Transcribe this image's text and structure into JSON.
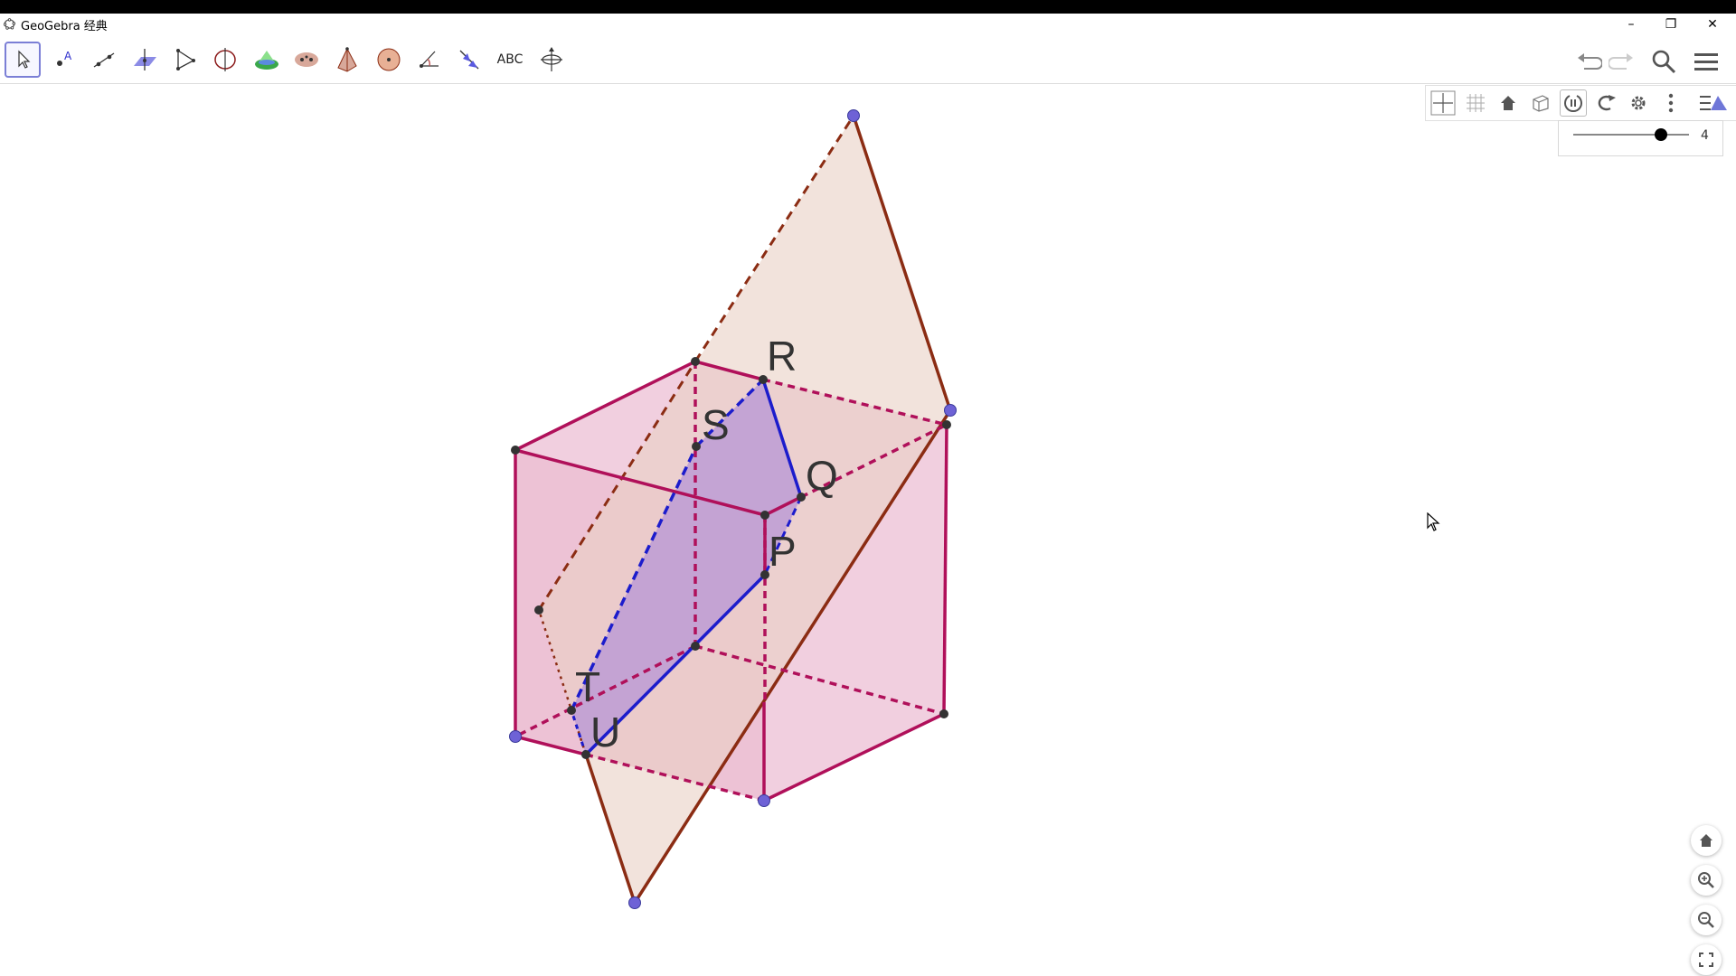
{
  "window": {
    "title": "GeoGebra 经典",
    "minimize": "–",
    "maximize": "❐",
    "close": "✕"
  },
  "toolbar": {
    "tools": [
      {
        "name": "move-tool-icon"
      },
      {
        "name": "point-tool-icon"
      },
      {
        "name": "line-tool-icon"
      },
      {
        "name": "perpendicular-tool-icon"
      },
      {
        "name": "polygon-tool-icon"
      },
      {
        "name": "circle-axis-tool-icon"
      },
      {
        "name": "plane-tool-icon"
      },
      {
        "name": "intersect-tool-icon"
      },
      {
        "name": "pyramid-tool-icon"
      },
      {
        "name": "sphere-tool-icon"
      },
      {
        "name": "angle-tool-icon"
      },
      {
        "name": "reflect-tool-icon"
      },
      {
        "name": "text-tool",
        "label": "ABC"
      },
      {
        "name": "rotate-view-tool-icon"
      }
    ],
    "right": [
      "undo-icon",
      "redo-icon",
      "search-icon",
      "menu-icon"
    ]
  },
  "style_bar": {
    "buttons": [
      "axes-icon",
      "grid-icon",
      "home-icon",
      "view-cube-icon",
      "rotate-icon",
      "projection-icon",
      "settings-icon",
      "more-icon",
      "collapse-icon"
    ],
    "slider_value": "4",
    "slider_fraction": 0.76
  },
  "labels": {
    "R": "R",
    "S": "S",
    "Q": "Q",
    "P": "P",
    "T": "T",
    "U": "U"
  },
  "nav": [
    "home-view-icon",
    "zoom-in-icon",
    "zoom-out-icon",
    "fullscreen-icon"
  ],
  "colors": {
    "cube_edge": "#b0105a",
    "cube_fill": "#e6a8c4",
    "plane_edge": "#8b2c13",
    "plane_fill": "#ead0c4",
    "section": "#1c1ccc",
    "section_fill": "#b492d6",
    "point_blue": "#6e62d6"
  }
}
